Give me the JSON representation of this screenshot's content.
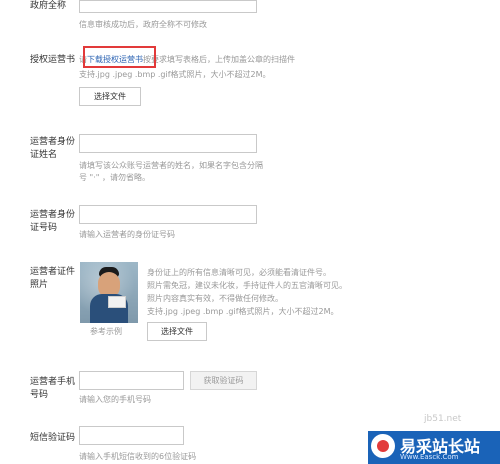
{
  "form": {
    "gov_name": {
      "label": "政府全称",
      "help": "信息审核成功后，政府全称不可修改"
    },
    "authorization_letter": {
      "label": "授权运营书",
      "help_prefix": "请",
      "help_link": "下载授权运营书",
      "help_suffix": "按要求填写表格后，上传加盖公章的扫描件",
      "help_line2": "支持.jpg .jpeg .bmp .gif格式照片，大小不超过2M。",
      "choose_file": "选择文件"
    },
    "operator_name": {
      "label_line1": "运营者身份",
      "label_line2": "证姓名",
      "help_line1": "请填写该公众账号运营者的姓名，如果名字包含分隔",
      "help_line2": "号 \"·\" ，请勿省略。"
    },
    "operator_id": {
      "label_line1": "运营者身份",
      "label_line2": "证号码",
      "help": "请输入运营者的身份证号码"
    },
    "operator_photo": {
      "label_line1": "运营者证件",
      "label_line2": "照片",
      "help_line1": "身份证上的所有信息清晰可见，必须能看清证件号。",
      "help_line2": "照片需免冠，建议未化妆，手持证件人的五官清晰可见。",
      "help_line3": "照片内容真实有效，不得做任何修改。",
      "help_line4": "支持.jpg .jpeg .bmp .gif格式照片，大小不超过2M。",
      "example": "参考示例",
      "choose_file": "选择文件"
    },
    "operator_phone": {
      "label_line1": "运营者手机",
      "label_line2": "号码",
      "help": "请输入您的手机号码",
      "get_code": "获取验证码"
    },
    "sms_code": {
      "label": "短信验证码",
      "help": "请输入手机短信收到的6位验证码"
    }
  },
  "watermark": {
    "site_text": "jb51.net",
    "logo_text": "易采站长站",
    "logo_subtext": "Www.Easck.Com"
  }
}
